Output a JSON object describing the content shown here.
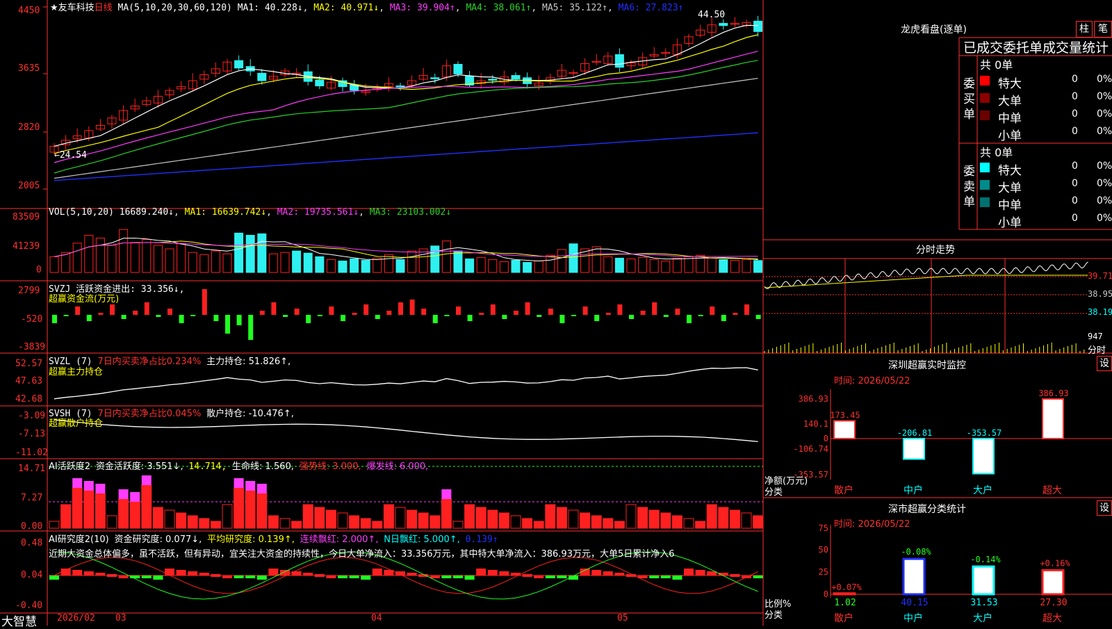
{
  "colors": {
    "up": "#ff2020",
    "down": "#2ff0f0",
    "ma1": "#ffffff",
    "ma2": "#ffff00",
    "ma3": "#ff3cff",
    "ma4": "#28d228",
    "ma5": "#c8c8c8",
    "ma6": "#2030ff",
    "grid": "#8b0000",
    "axis": "#ff3030"
  },
  "header": {
    "stock": "★友车科技",
    "period": "日线",
    "ma_params": "MA(5,10,20,30,60,120)",
    "ma1": "MA1: 40.228↓",
    "ma2": "MA2: 40.971↓",
    "ma3": "MA3: 39.904↑",
    "ma4": "MA4: 38.061↑",
    "ma5": "MA5: 35.122↑",
    "ma6": "MA6: 27.823↑",
    "high_mark": "44.50",
    "low_mark": "←24.54"
  },
  "price_axis": [
    "4450",
    "3635",
    "2820",
    "2005"
  ],
  "vol": {
    "label": "VOL(5,10,20) 16689.240↓",
    "ma1": "MA1: 16639.742↓",
    "ma2": "MA2: 19735.561↓",
    "ma3": "MA3: 23103.002↓",
    "axis": [
      "83509",
      "41239",
      "0"
    ]
  },
  "svzj": {
    "label": "SVZJ  活跃资金进出: 33.356↓,",
    "sub": "超赢资金流(万元)",
    "axis": [
      "2799",
      "-520",
      "-3839"
    ]
  },
  "svzl": {
    "label": "SVZL (7)",
    "net": "7日内买卖净占比0.234%",
    "hold": "主力持仓: 51.826↑,",
    "sub": "超赢主力持仓",
    "axis": [
      "52.57",
      "47.63",
      "42.68"
    ]
  },
  "svsh": {
    "label": "SVSH (7)",
    "net": "7日内买卖净占比0.045%",
    "hold": "散户持仓: -10.476↑,",
    "sub": "超赢散户持仓",
    "axis": [
      "-3.09",
      "-7.13",
      "-11.02"
    ]
  },
  "ai1": {
    "label": "AI活跃度2",
    "act": "资金活跃度: 3.551↓,",
    "v2": "14.714,",
    "life": "生命线: 1.560,",
    "strong": "强势线: 3.000,",
    "burst": "爆发线: 6.000,",
    "axis": [
      "14.71",
      "7.27",
      "0.00"
    ]
  },
  "ai2": {
    "label": "AI研究度2(10)",
    "r1": "资金研究度: 0.077↓,",
    "r2": "平均研究度: 0.139↑,",
    "r3": "连续飘红: 2.000↑,",
    "r4": "N日飘红: 5.000↑,",
    "r5": "0.139↑",
    "comment": "近期大资金总体偏多，虽不活跃，但有异动，宜关注大资金的持续性，今日大单净流入：33.356万元，其中特大单净流入：386.93万元，大单5日累计净入6",
    "axis": [
      "0.48",
      "0.04",
      "-0.40"
    ]
  },
  "bottom": {
    "brand": "大智慧",
    "dates": [
      "2026/02",
      "03",
      "04",
      "05"
    ]
  },
  "right": {
    "lhb_title": "龙虎看盘(逐单)",
    "btn_bar": "柱",
    "btn_pen": "笔",
    "tabs_title": "已成交委托单成交量统计",
    "buy_side": "委买单",
    "sell_side": "委卖单",
    "buy_total": "共 0单",
    "sell_total": "共 0单",
    "buy_rows": [
      {
        "name": "特大",
        "v": "0",
        "p": "0%",
        "c": "#ff0000"
      },
      {
        "name": "大单",
        "v": "0",
        "p": "0%",
        "c": "#8b0000"
      },
      {
        "name": "中单",
        "v": "0",
        "p": "0%",
        "c": "#6b0000"
      },
      {
        "name": "小单",
        "v": "0",
        "p": "0%",
        "c": "#000000"
      }
    ],
    "sell_rows": [
      {
        "name": "特大",
        "v": "0",
        "p": "0%",
        "c": "#00ffff"
      },
      {
        "name": "大单",
        "v": "0",
        "p": "0%",
        "c": "#008b8b"
      },
      {
        "name": "中单",
        "v": "0",
        "p": "0%",
        "c": "#007070"
      },
      {
        "name": "小单",
        "v": "0",
        "p": "0%",
        "c": "#000000"
      }
    ],
    "intraday_title": "分时走势",
    "intraday_axis": [
      "39.71",
      "38.95",
      "38.19"
    ],
    "intraday_vol": [
      "947",
      "分时"
    ],
    "sz_title": "深圳超赢实时监控",
    "set": "设",
    "time": "时间: 2026/05/22",
    "net_label": "净额(万元)",
    "cat_label": "分类",
    "sz_axis": [
      "386.93",
      "140.1",
      "0",
      "-106.74",
      "-353.57"
    ],
    "sz_cats": [
      "散户",
      "中户",
      "大户",
      "超大"
    ],
    "sz_vals": [
      173.45,
      -206.81,
      -353.57,
      386.93
    ],
    "sz_labels": [
      "173.45",
      "-206.81",
      "-353.57",
      "386.93"
    ],
    "cls_title": "深市超赢分类统计",
    "cls_axis": [
      "75",
      "50",
      "25",
      "0"
    ],
    "ratio_label": "比例%",
    "cls_vals": [
      1.02,
      40.15,
      31.53,
      27.3
    ],
    "cls_vals_txt": [
      "1.02",
      "40.15",
      "31.53",
      "27.30"
    ],
    "cls_chg": [
      "+0.07%",
      "-0.08%",
      "-0.14%",
      "+0.16%"
    ]
  }
}
